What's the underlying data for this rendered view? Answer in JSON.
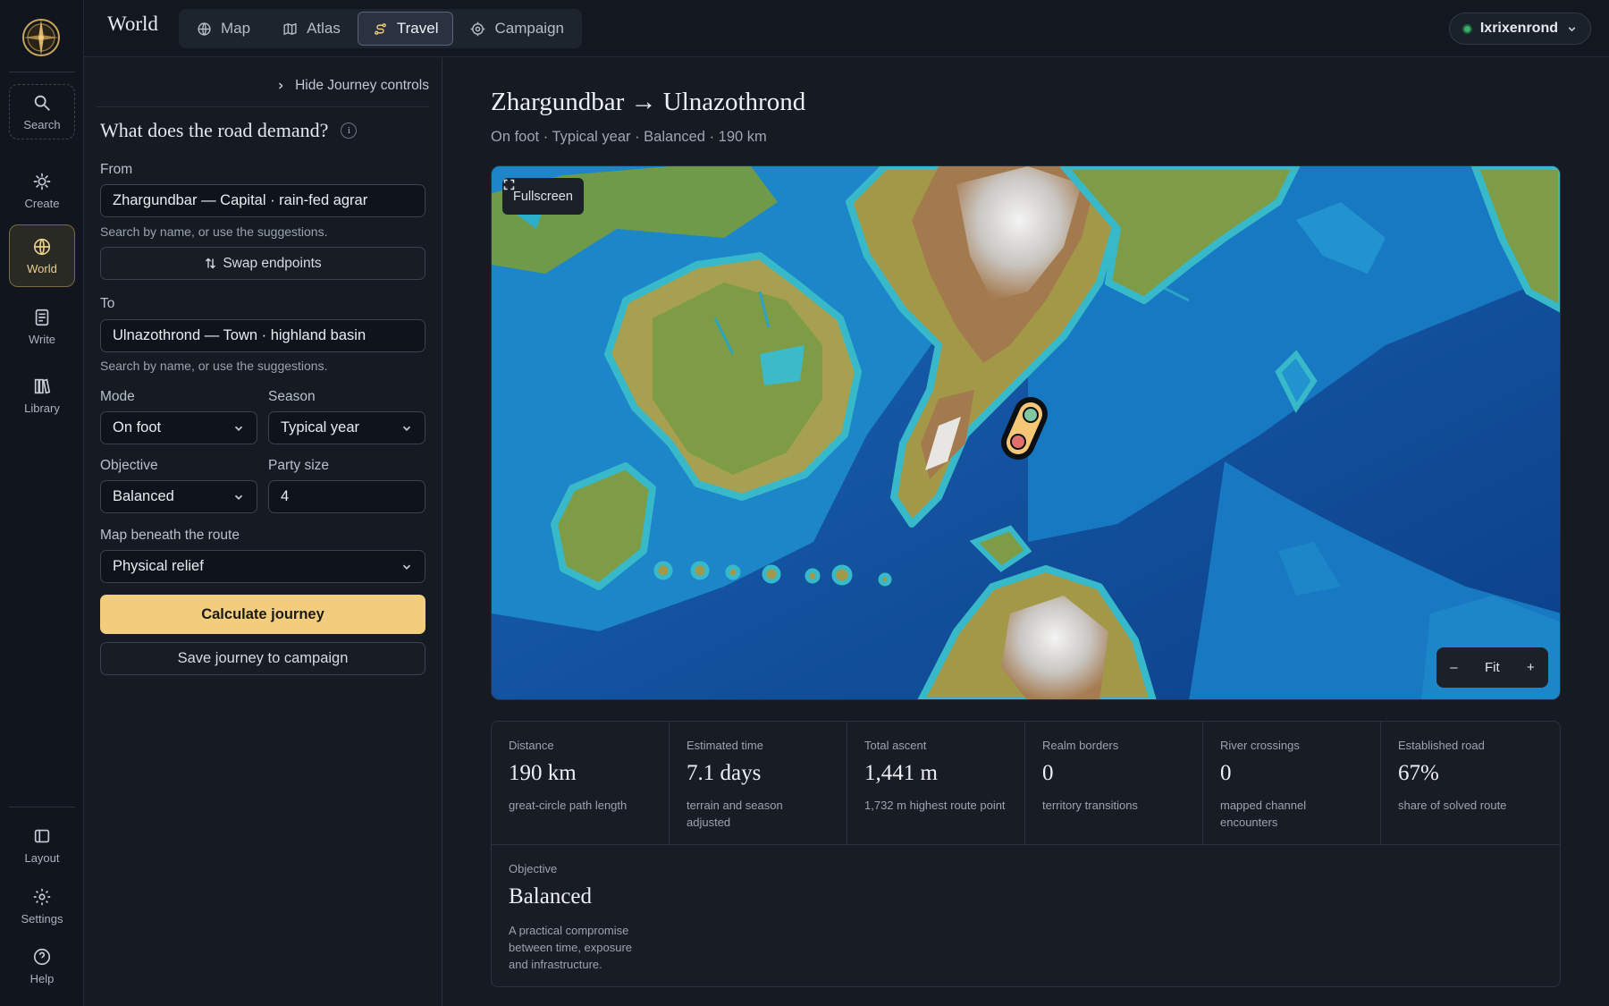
{
  "app": {
    "title": "World"
  },
  "nav_tabs": [
    {
      "label": "Map",
      "icon": "globe-icon"
    },
    {
      "label": "Atlas",
      "icon": "map-icon"
    },
    {
      "label": "Travel",
      "icon": "route-icon"
    },
    {
      "label": "Campaign",
      "icon": "target-icon"
    }
  ],
  "rail": {
    "search": "Search",
    "create": "Create",
    "world": "World",
    "write": "Write",
    "library": "Library",
    "layout": "Layout",
    "settings": "Settings",
    "help": "Help"
  },
  "user": {
    "name": "Ixrixenrond",
    "status_color": "#3bb06a"
  },
  "panel": {
    "hide_label": "Hide Journey controls",
    "question": "What does the road demand?",
    "from_label": "From",
    "from_value": "Zhargundbar — Capital · rain-fed agrar",
    "from_hint": "Search by name, or use the suggestions.",
    "swap_label": "Swap endpoints",
    "to_label": "To",
    "to_value": "Ulnazothrond — Town · highland basin",
    "to_hint": "Search by name, or use the suggestions.",
    "mode_label": "Mode",
    "mode_value": "On foot",
    "season_label": "Season",
    "season_value": "Typical year",
    "objective_label": "Objective",
    "objective_value": "Balanced",
    "party_label": "Party size",
    "party_value": "4",
    "basemap_label": "Map beneath the route",
    "basemap_value": "Physical relief",
    "calculate_label": "Calculate journey",
    "save_label": "Save journey to campaign"
  },
  "journey": {
    "title": "Zhargundbar → Ulnazothrond",
    "subtitle": "On foot · Typical year · Balanced · 190 km"
  },
  "map": {
    "fullscreen_label": "Fullscreen",
    "zoom_out": "–",
    "zoom_fit": "Fit",
    "zoom_in": "+",
    "start_color": "#7fc8a0",
    "end_color": "#e0706a"
  },
  "stats": [
    {
      "label": "Distance",
      "value": "190 km",
      "desc": "great-circle path length"
    },
    {
      "label": "Estimated time",
      "value": "7.1 days",
      "desc": "terrain and season adjusted"
    },
    {
      "label": "Total ascent",
      "value": "1,441 m",
      "desc": "1,732 m highest route point"
    },
    {
      "label": "Realm borders",
      "value": "0",
      "desc": "territory transitions"
    },
    {
      "label": "River crossings",
      "value": "0",
      "desc": "mapped channel encounters"
    },
    {
      "label": "Established road",
      "value": "67%",
      "desc": "share of solved route"
    }
  ],
  "objective_card": {
    "label": "Objective",
    "value": "Balanced",
    "desc": "A practical compromise between time, exposure and infrastructure."
  },
  "colors": {
    "accent": "#f1cd7d",
    "background": "#151a23"
  }
}
